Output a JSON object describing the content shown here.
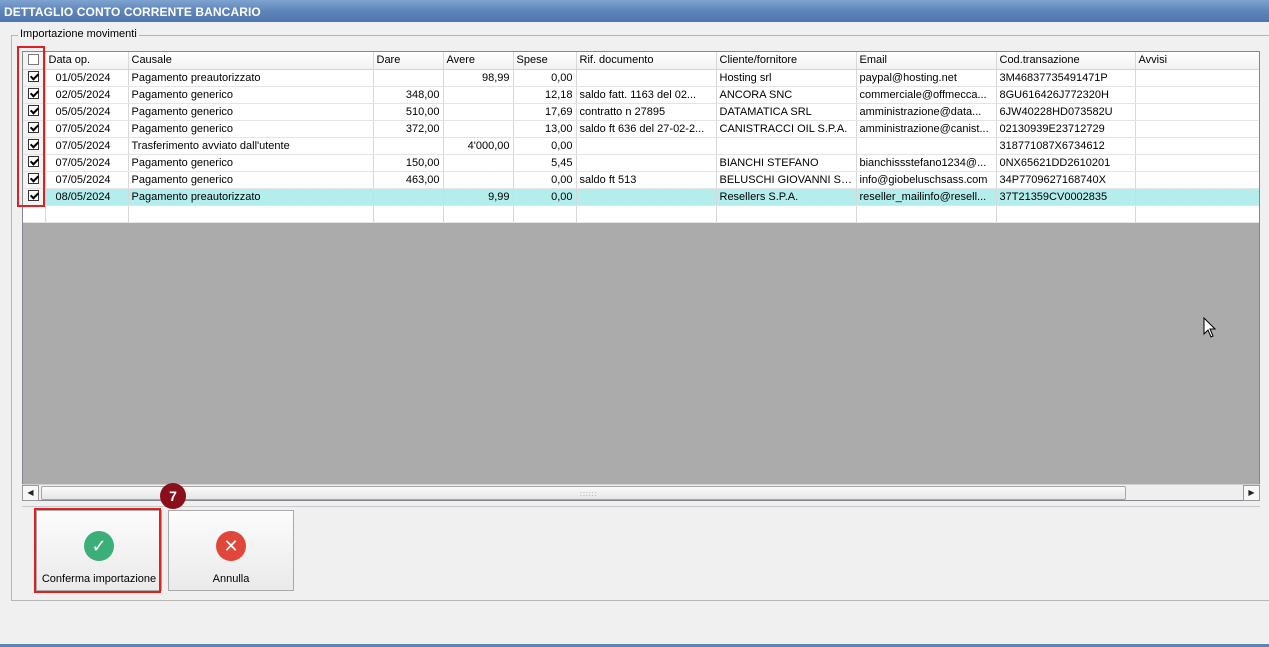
{
  "window": {
    "title": "DETTAGLIO CONTO CORRENTE BANCARIO"
  },
  "group": {
    "label": "Importazione movimenti"
  },
  "grid": {
    "columns": [
      "Data op.",
      "Causale",
      "Dare",
      "Avere",
      "Spese",
      "Rif. documento",
      "Cliente/fornitore",
      "Email",
      "Cod.transazione",
      "Avvisi"
    ],
    "header_checked": false,
    "rows": [
      {
        "checked": true,
        "date": "01/05/2024",
        "causale": "Pagamento preautorizzato",
        "dare": "",
        "avere": "98,99",
        "spese": "0,00",
        "rif": "",
        "cliente": "Hosting srl",
        "email": "paypal@hosting.net",
        "cod": "3M46837735491471P",
        "avvisi": ""
      },
      {
        "checked": true,
        "date": "02/05/2024",
        "causale": "Pagamento generico",
        "dare": "348,00",
        "avere": "",
        "spese": "12,18",
        "rif": "saldo fatt.   1163 del 02...",
        "cliente": "ANCORA SNC",
        "email": "commerciale@offmecca...",
        "cod": "8GU616426J772320H",
        "avvisi": ""
      },
      {
        "checked": true,
        "date": "05/05/2024",
        "causale": "Pagamento generico",
        "dare": "510,00",
        "avere": "",
        "spese": "17,69",
        "rif": "contratto n 27895",
        "cliente": "DATAMATICA SRL",
        "email": "amministrazione@data...",
        "cod": "6JW40228HD073582U",
        "avvisi": ""
      },
      {
        "checked": true,
        "date": "07/05/2024",
        "causale": "Pagamento generico",
        "dare": "372,00",
        "avere": "",
        "spese": "13,00",
        "rif": "saldo ft 636 del 27-02-2...",
        "cliente": "CANISTRACCI OIL S.P.A.",
        "email": "amministrazione@canist...",
        "cod": "02130939E23712729",
        "avvisi": ""
      },
      {
        "checked": true,
        "date": "07/05/2024",
        "causale": "Trasferimento avviato dall'utente",
        "dare": "",
        "avere": "4'000,00",
        "spese": "0,00",
        "rif": "",
        "cliente": "",
        "email": "",
        "cod": "318771087X6734612",
        "avvisi": ""
      },
      {
        "checked": true,
        "date": "07/05/2024",
        "causale": "Pagamento generico",
        "dare": "150,00",
        "avere": "",
        "spese": "5,45",
        "rif": "",
        "cliente": "BIANCHI STEFANO",
        "email": "bianchissstefano1234@...",
        "cod": "0NX65621DD2610201",
        "avvisi": ""
      },
      {
        "checked": true,
        "date": "07/05/2024",
        "causale": "Pagamento generico",
        "dare": "463,00",
        "avere": "",
        "spese": "0,00",
        "rif": "saldo ft 513",
        "cliente": "BELUSCHI GIOVANNI SAS",
        "email": "info@giobeluschsass.com",
        "cod": "34P7709627168740X",
        "avvisi": ""
      },
      {
        "checked": true,
        "date": "08/05/2024",
        "causale": "Pagamento preautorizzato",
        "dare": "",
        "avere": "9,99",
        "spese": "0,00",
        "rif": "",
        "cliente": "Resellers S.P.A.",
        "email": "reseller_mailinfo@resell...",
        "cod": "37T21359CV0002835",
        "avvisi": ""
      }
    ],
    "selected_row": 7
  },
  "buttons": {
    "confirm_label": "Conferma importazione",
    "cancel_label": "Annulla",
    "confirm_icon": "check-circle-icon",
    "cancel_icon": "x-circle-icon"
  },
  "annotation": {
    "step": "7"
  },
  "colors": {
    "title_bar": "#5d85ba",
    "selected_row": "#b3eeec",
    "confirm": "#3cae78",
    "cancel": "#e0473a",
    "highlight": "#e02020",
    "badge": "#8a0f1a"
  }
}
